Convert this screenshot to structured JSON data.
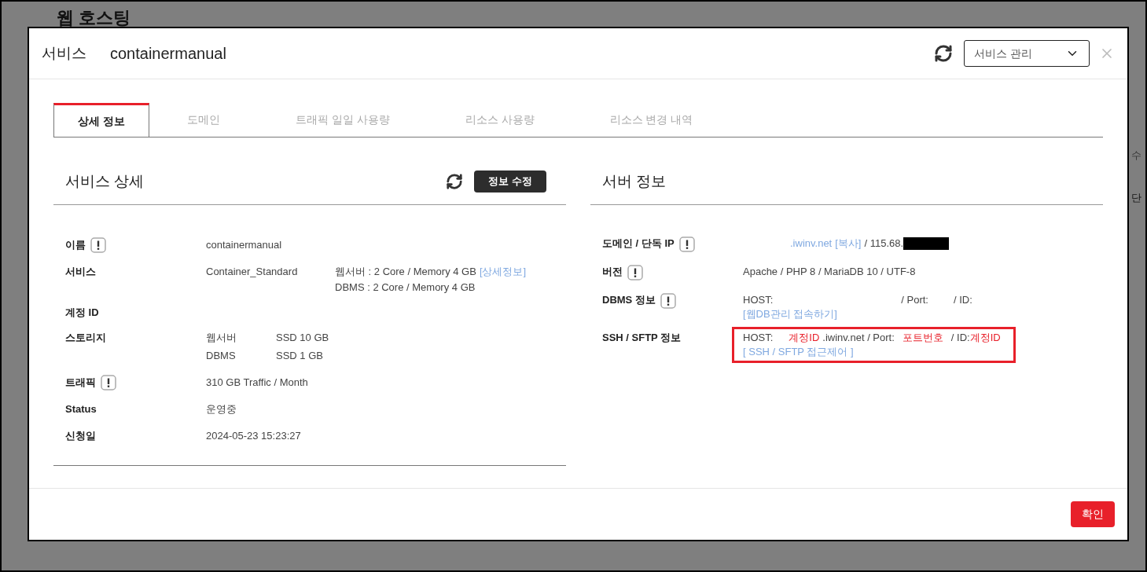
{
  "background": {
    "title": "웹 호스팅",
    "column_header": "수",
    "cell": "단"
  },
  "modal": {
    "label": "서비스",
    "name": "containermanual",
    "select": "서비스 관리"
  },
  "tabs": [
    {
      "label": "상세 정보",
      "selected": true
    },
    {
      "label": "도메인",
      "selected": false
    },
    {
      "label": "트래픽 일일 사용량",
      "selected": false
    },
    {
      "label": "리소스 사용량",
      "selected": false
    },
    {
      "label": "리소스 변경 내역",
      "selected": false
    }
  ],
  "left": {
    "title": "서비스 상세",
    "edit_button": "정보 수정",
    "rows": [
      {
        "label": "이름",
        "info": true,
        "kind": "plain",
        "columns": [
          [
            [
              {
                "text": "containermanual",
                "kind": "text"
              }
            ]
          ]
        ]
      },
      {
        "label": "서비스",
        "info": false,
        "kind": "split",
        "columns": [
          [
            [
              {
                "text": "Container_Standard",
                "kind": "text"
              }
            ]
          ],
          [
            [
              {
                "text": "웹서버 : 2 Core / Memory 4 GB",
                "kind": "text"
              },
              {
                "text": "[상세정보]",
                "kind": "link"
              }
            ],
            [
              {
                "text": "DBMS : 2 Core / Memory 4 GB",
                "kind": "text"
              }
            ]
          ]
        ]
      },
      {
        "label": "계정 ID",
        "info": false,
        "kind": "empty",
        "columns": []
      },
      {
        "label": "스토리지",
        "info": false,
        "kind": "table",
        "columns": [
          [
            [
              {
                "text": "웹서버",
                "kind": "text"
              }
            ],
            [
              {
                "text": "DBMS",
                "kind": "text"
              }
            ]
          ],
          [
            [
              {
                "text": "SSD 10 GB",
                "kind": "text"
              }
            ],
            [
              {
                "text": "SSD 1 GB",
                "kind": "text"
              }
            ]
          ]
        ]
      },
      {
        "label": "트래픽",
        "info": true,
        "kind": "plain",
        "columns": [
          [
            [
              {
                "text": "310 GB Traffic / Month",
                "kind": "text"
              }
            ]
          ]
        ]
      },
      {
        "label": "Status",
        "info": false,
        "kind": "plain",
        "columns": [
          [
            [
              {
                "text": "운영중",
                "kind": "text"
              }
            ]
          ]
        ]
      },
      {
        "label": "신청일",
        "info": false,
        "kind": "plain",
        "columns": [
          [
            [
              {
                "text": "2024-05-23 15:23:27",
                "kind": "text"
              }
            ]
          ]
        ]
      }
    ]
  },
  "right": {
    "title": "서버 정보",
    "rows": [
      {
        "label": "도메인 / 단독 IP",
        "info": true,
        "highlighted": false,
        "redacted": true,
        "lines": [
          [
            {
              "text": ".iwinv.net",
              "kind": "link"
            },
            {
              "text": "[복사]",
              "kind": "link"
            },
            {
              "text": "/ 115.68.",
              "kind": "text"
            }
          ]
        ]
      },
      {
        "label": "버전",
        "info": true,
        "highlighted": false,
        "redacted": false,
        "lines": [
          [
            {
              "text": "Apache / PHP 8 / MariaDB 10 / UTF-8",
              "kind": "text"
            }
          ]
        ]
      },
      {
        "label": "DBMS 정보",
        "info": true,
        "highlighted": false,
        "redacted": false,
        "lines": [
          [
            {
              "text": "HOST:",
              "kind": "text"
            },
            {
              "text": "/ Port:",
              "kind": "text"
            },
            {
              "text": "/ ID:",
              "kind": "text"
            }
          ],
          [
            {
              "text": "[웹DB관리 접속하기]",
              "kind": "link"
            }
          ]
        ]
      },
      {
        "label": "SSH / SFTP 정보",
        "info": false,
        "highlighted": true,
        "redacted": false,
        "lines": [
          [
            {
              "text": "HOST:",
              "kind": "text"
            },
            {
              "text": "계정ID",
              "kind": "emphasis"
            },
            {
              "text": ".iwinv.net / Port:",
              "kind": "text"
            },
            {
              "text": "포트번호",
              "kind": "emphasis"
            },
            {
              "text": "/ ID:",
              "kind": "text"
            },
            {
              "text": "계정ID",
              "kind": "emphasis"
            }
          ],
          [
            {
              "text": "[ SSH / SFTP 접근제어 ]",
              "kind": "link"
            }
          ]
        ]
      }
    ]
  },
  "footer_button": "확인"
}
